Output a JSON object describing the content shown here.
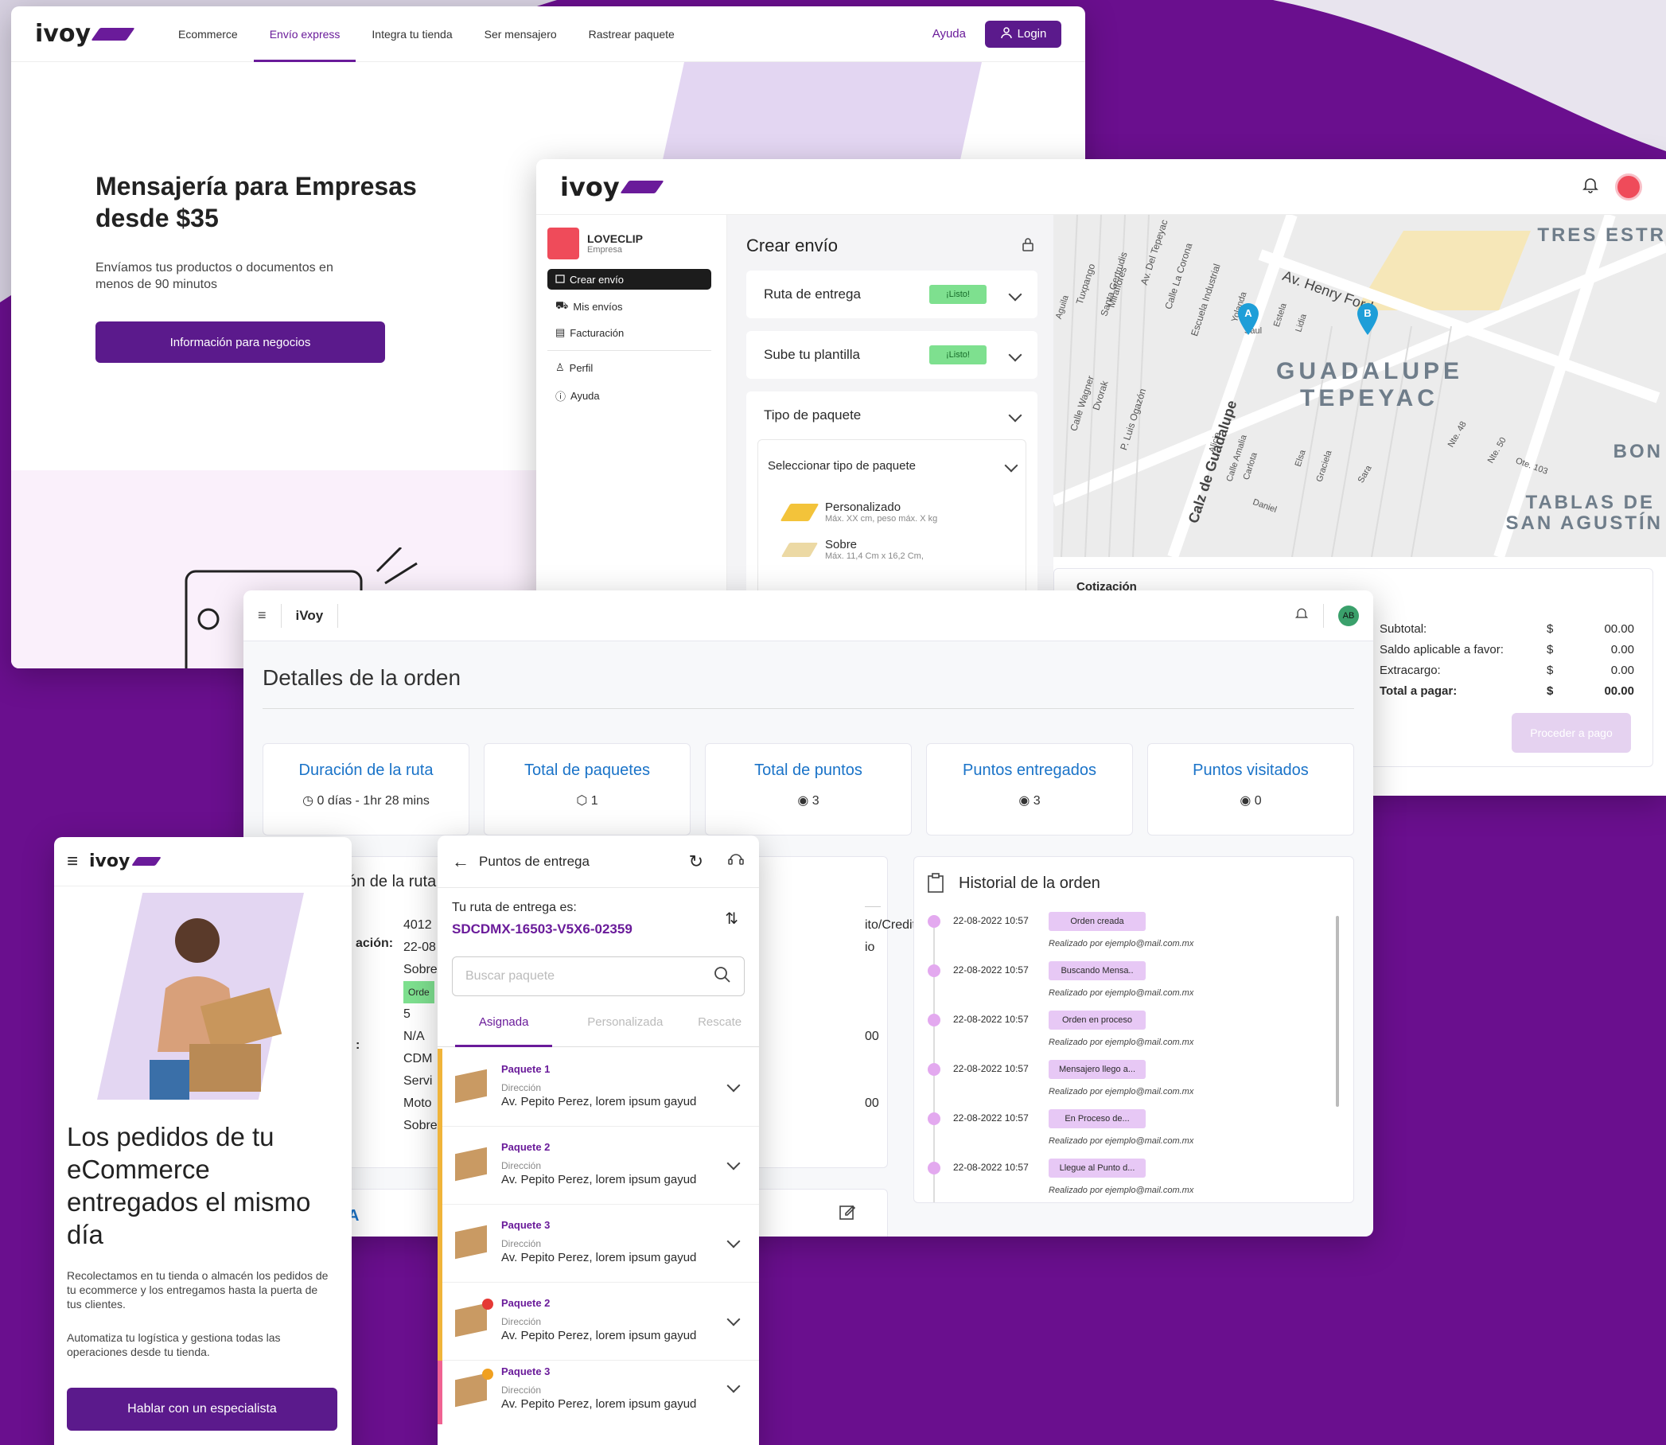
{
  "colors": {
    "brand": "#6a0f8e",
    "accent": "#5b1a8c",
    "active": "#6a1b9a",
    "listo_bg": "#7ee08f",
    "pill": "#e7c8f5",
    "link_blue": "#1a73c8"
  },
  "landing": {
    "logo": "ivoy",
    "nav": [
      "Ecommerce",
      "Envío express",
      "Integra tu tienda",
      "Ser mensajero",
      "Rastrear paquete"
    ],
    "help": "Ayuda",
    "login": "Login",
    "headline": "Mensajería para Empresas desde $35",
    "subtext": "Envíamos tus productos o documentos en menos de 90 minutos",
    "cta": "Información para negocios"
  },
  "dashboard": {
    "logo": "ivoy",
    "company_name": "LOVECLIP",
    "company_type": "Empresa",
    "menu": [
      {
        "label": "Crear envío",
        "icon": "calendar-icon"
      },
      {
        "label": "Mis envíos",
        "icon": "truck-icon"
      },
      {
        "label": "Facturación",
        "icon": "invoice-icon"
      },
      {
        "label": "Perfil",
        "icon": "user-icon"
      },
      {
        "label": "Ayuda",
        "icon": "help-icon"
      }
    ],
    "form_title": "Crear envío",
    "sections": [
      {
        "label": "Ruta de entrega",
        "status": "¡Listo!"
      },
      {
        "label": "Sube tu plantilla",
        "status": "¡Listo!"
      }
    ],
    "package_section": "Tipo de paquete",
    "package_select": "Seleccionar tipo de paquete",
    "packages": [
      {
        "name": "Personalizado",
        "desc": "Máx. XX cm, peso máx. X kg"
      },
      {
        "name": "Sobre",
        "desc": "Máx. 11,4 Cm x 16,2 Cm,"
      }
    ],
    "map": {
      "districts": [
        "TRES ESTR",
        "GUADALUPE",
        "TEPEYAC",
        "BON",
        "TABLAS DE",
        "SAN AGUSTÍN"
      ],
      "streets": [
        "Av. Henry Ford",
        "Calz de Guadalupe",
        "Calle Wagner",
        "Dvorak",
        "P. Luis Ogazón",
        "Tuxpango",
        "Santa Gertrudis",
        "Miraflores",
        "Av. Del Tepeyac",
        "Calle La Corona",
        "Escuela Industrial",
        "Yolanda",
        "Saul",
        "Estela",
        "Lidia",
        "Alicia",
        "Calle Amalia",
        "Carlota",
        "Daniel",
        "Elsa",
        "Graciela",
        "Sara",
        "Nte. 48",
        "Nte. 50",
        "Ote. 103",
        "Aguila"
      ],
      "pins": [
        "A",
        "B"
      ]
    },
    "summary": [
      {
        "label": "Subtotal:",
        "currency": "$",
        "amount": "00.00"
      },
      {
        "label": "Saldo aplicable a favor:",
        "currency": "$",
        "amount": "0.00"
      },
      {
        "label": "Extracargo:",
        "currency": "$",
        "amount": "0.00"
      },
      {
        "label": "Total a pagar:",
        "currency": "$",
        "amount": "00.00"
      }
    ],
    "summary_heading": "Cotización",
    "proceed": "Proceder a pago"
  },
  "order": {
    "logo": "iVoy",
    "avatar": "AB",
    "title": "Detalles de la orden",
    "stats": [
      {
        "label": "Duración de la ruta",
        "value": "0 días - 1hr 28 mins",
        "icon": "clock-icon"
      },
      {
        "label": "Total de paquetes",
        "value": "1",
        "icon": "box-icon"
      },
      {
        "label": "Total de puntos",
        "value": "3",
        "icon": "location-icon"
      },
      {
        "label": "Puntos entregados",
        "value": "3",
        "icon": "location-icon"
      },
      {
        "label": "Puntos visitados",
        "value": "0",
        "icon": "location-icon"
      }
    ],
    "route_card_title": "ón de la ruta",
    "route_labels": [
      "ación:",
      ":"
    ],
    "route_values": [
      "4012",
      "22-08",
      "Sobre",
      "Orde",
      "5",
      "N/A",
      "CDM",
      "Servi",
      "Moto",
      "Sobre"
    ],
    "right_values": [
      "ito/Credito",
      "io",
      "00",
      "00"
    ],
    "letter_a": "A",
    "history_title": "Historial de la orden",
    "history": [
      {
        "date": "22-08-2022 10:57",
        "status": "Orden creada",
        "by": "Realizado por ejemplo@mail.com.mx"
      },
      {
        "date": "22-08-2022 10:57",
        "status": "Buscando Mensa..",
        "by": "Realizado por ejemplo@mail.com.mx"
      },
      {
        "date": "22-08-2022 10:57",
        "status": "Orden en proceso",
        "by": "Realizado por ejemplo@mail.com.mx"
      },
      {
        "date": "22-08-2022 10:57",
        "status": "Mensajero llego a...",
        "by": "Realizado por ejemplo@mail.com.mx"
      },
      {
        "date": "22-08-2022 10:57",
        "status": "En Proceso de...",
        "by": "Realizado por ejemplo@mail.com.mx"
      },
      {
        "date": "22-08-2022 10:57",
        "status": "Llegue al Punto d...",
        "by": "Realizado por ejemplo@mail.com.mx"
      }
    ]
  },
  "mobile_landing": {
    "logo": "ivoy",
    "headline": "Los pedidos de tu eCommerce entregados el mismo día",
    "p1": "Recolectamos en tu tienda o almacén los pedidos de tu ecommerce y los entregamos hasta la puerta de tus clientes.",
    "p2": "Automatiza tu logística y gestiona todas las operaciones desde tu tienda.",
    "cta": "Hablar con un especialista"
  },
  "mobile_points": {
    "title": "Puntos de entrega",
    "route_label": "Tu ruta de entrega es:",
    "route_code": "SDCDMX-16503-V5X6-02359",
    "search_placeholder": "Buscar paquete",
    "tabs": [
      "Asignada",
      "Personalizada",
      "Rescate"
    ],
    "packages": [
      {
        "name": "Paquete  1",
        "addr_label": "Dirección",
        "addr": "Av. Pepito Perez, lorem ipsum gayud",
        "bar": "#f0b43a",
        "badge": ""
      },
      {
        "name": "Paquete  2",
        "addr_label": "Dirección",
        "addr": "Av. Pepito Perez, lorem ipsum gayud",
        "bar": "#f0b43a",
        "badge": ""
      },
      {
        "name": "Paquete  3",
        "addr_label": "Dirección",
        "addr": "Av. Pepito Perez, lorem ipsum gayud",
        "bar": "#f0b43a",
        "badge": ""
      },
      {
        "name": "Paquete  2",
        "addr_label": "Dirección",
        "addr": "Av. Pepito Perez, lorem ipsum gayud",
        "bar": "#f0b43a",
        "badge": "#e53935"
      },
      {
        "name": "Paquete  3",
        "addr_label": "Dirección",
        "addr": "Av. Pepito Perez, lorem ipsum gayud",
        "bar": "#f06292",
        "badge": "#f0a020"
      }
    ]
  }
}
